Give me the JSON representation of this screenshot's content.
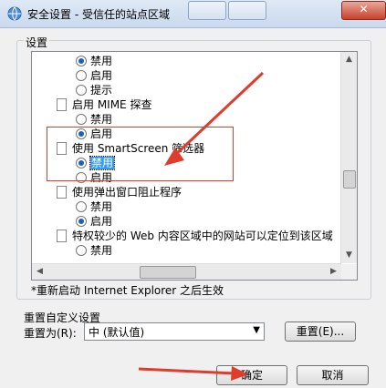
{
  "window": {
    "title": "安全设置 - 受信任的站点区域",
    "close_glyph": "✕"
  },
  "settings": {
    "label": "设置",
    "rows": [
      {
        "kind": "radio",
        "checked": true,
        "label": "禁用"
      },
      {
        "kind": "radio",
        "checked": false,
        "label": "启用"
      },
      {
        "kind": "radio",
        "checked": false,
        "label": "提示"
      },
      {
        "kind": "header",
        "label": "启用 MIME 探查"
      },
      {
        "kind": "radio",
        "checked": false,
        "label": "禁用"
      },
      {
        "kind": "radio",
        "checked": true,
        "label": "启用"
      },
      {
        "kind": "header",
        "label": "使用 SmartScreen 筛选器"
      },
      {
        "kind": "radio",
        "checked": true,
        "label": "禁用",
        "selected": true
      },
      {
        "kind": "radio",
        "checked": false,
        "label": "启用"
      },
      {
        "kind": "header",
        "label": "使用弹出窗口阻止程序"
      },
      {
        "kind": "radio",
        "checked": false,
        "label": "禁用"
      },
      {
        "kind": "radio",
        "checked": true,
        "label": "启用"
      },
      {
        "kind": "header",
        "label": "特权较少的 Web 内容区域中的网站可以定位到该区域"
      },
      {
        "kind": "radio",
        "checked": false,
        "label": "禁用"
      }
    ],
    "note": "*重新启动 Internet Explorer 之后生效"
  },
  "reset": {
    "title": "重置自定义设置",
    "to_label": "重置为(R):",
    "level_value": "中 (默认值)",
    "reset_button": "重置(E)..."
  },
  "buttons": {
    "ok": "确定",
    "cancel": "取消"
  },
  "annotation_color": "#e03c2c"
}
